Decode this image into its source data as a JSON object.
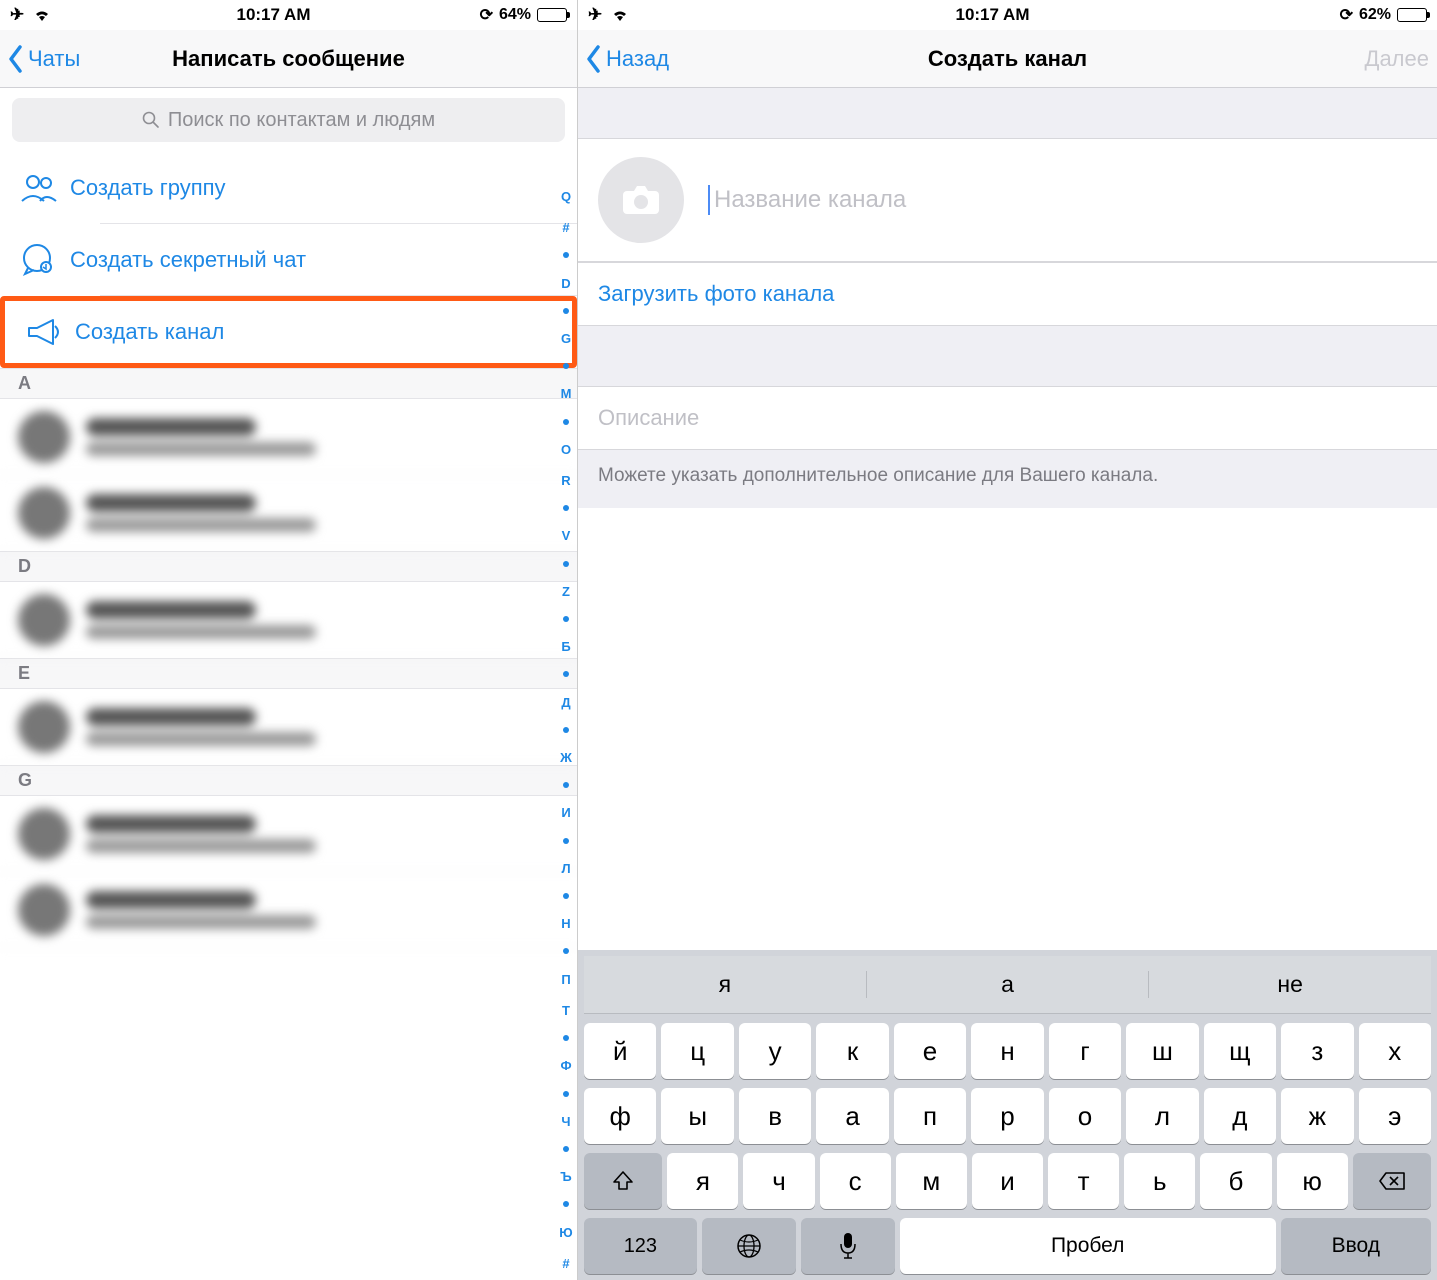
{
  "left": {
    "status": {
      "time": "10:17 AM",
      "battery_pct": "64%"
    },
    "nav": {
      "back": "Чаты",
      "title": "Написать сообщение"
    },
    "search": {
      "placeholder": "Поиск по контактам и людям"
    },
    "menu": {
      "group": "Создать группу",
      "secret": "Создать секретный чат",
      "channel": "Создать канал"
    },
    "sections": [
      "A",
      "D",
      "E",
      "G"
    ],
    "index": [
      "Q",
      "#",
      "●",
      "D",
      "●",
      "G",
      "●",
      "M",
      "●",
      "O",
      "R",
      "●",
      "V",
      "●",
      "Z",
      "●",
      "Б",
      "●",
      "Д",
      "●",
      "Ж",
      "●",
      "И",
      "●",
      "Л",
      "●",
      "Н",
      "●",
      "П",
      "Т",
      "●",
      "Ф",
      "●",
      "Ч",
      "●",
      "Ъ",
      "●",
      "Ю",
      "#"
    ]
  },
  "right": {
    "status": {
      "time": "10:17 AM",
      "battery_pct": "62%"
    },
    "nav": {
      "back": "Назад",
      "title": "Создать канал",
      "next": "Далее"
    },
    "name_placeholder": "Название канала",
    "upload": "Загрузить фото канала",
    "desc_placeholder": "Описание",
    "desc_hint": "Можете указать дополнительное описание для Вашего канала.",
    "suggestions": [
      "я",
      "а",
      "не"
    ],
    "kb": {
      "r1": [
        "й",
        "ц",
        "у",
        "к",
        "е",
        "н",
        "г",
        "ш",
        "щ",
        "з",
        "х"
      ],
      "r2": [
        "ф",
        "ы",
        "в",
        "а",
        "п",
        "р",
        "о",
        "л",
        "д",
        "ж",
        "э"
      ],
      "r3": [
        "я",
        "ч",
        "с",
        "м",
        "и",
        "т",
        "ь",
        "б",
        "ю"
      ],
      "num": "123",
      "space": "Пробел",
      "enter": "Ввод"
    }
  }
}
